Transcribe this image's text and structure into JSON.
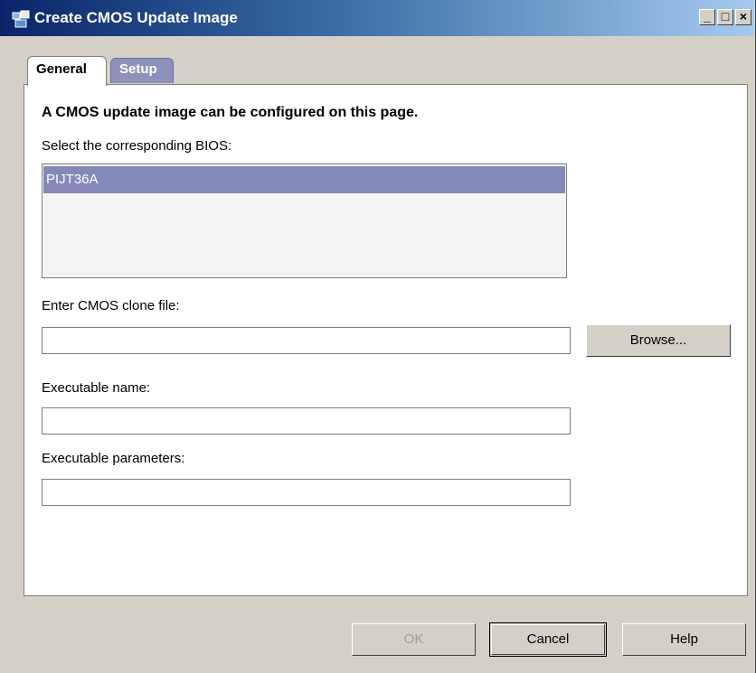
{
  "window": {
    "title": "Create CMOS Update Image",
    "icon": "app-icon",
    "controls": {
      "minimize": "_",
      "maximize": "□",
      "close": "×"
    }
  },
  "tabs": [
    {
      "label": "General",
      "active": true
    },
    {
      "label": "Setup",
      "active": false
    }
  ],
  "page": {
    "heading": "A CMOS update image can be configured on this page.",
    "bios_label": "Select the corresponding BIOS:",
    "bios_list": [
      "PIJT36A"
    ],
    "bios_selected": "PIJT36A",
    "clone_label": "Enter CMOS clone file:",
    "clone_value": "",
    "browse_label": "Browse...",
    "exe_name_label": "Executable name:",
    "exe_name_value": "",
    "exe_params_label": "Executable parameters:",
    "exe_params_value": ""
  },
  "footer": {
    "ok_label": "OK",
    "cancel_label": "Cancel",
    "help_label": "Help"
  },
  "colors": {
    "titlebar": "#0a246a",
    "selection": "#8489b8",
    "tab_inactive": "#8d92bd"
  }
}
